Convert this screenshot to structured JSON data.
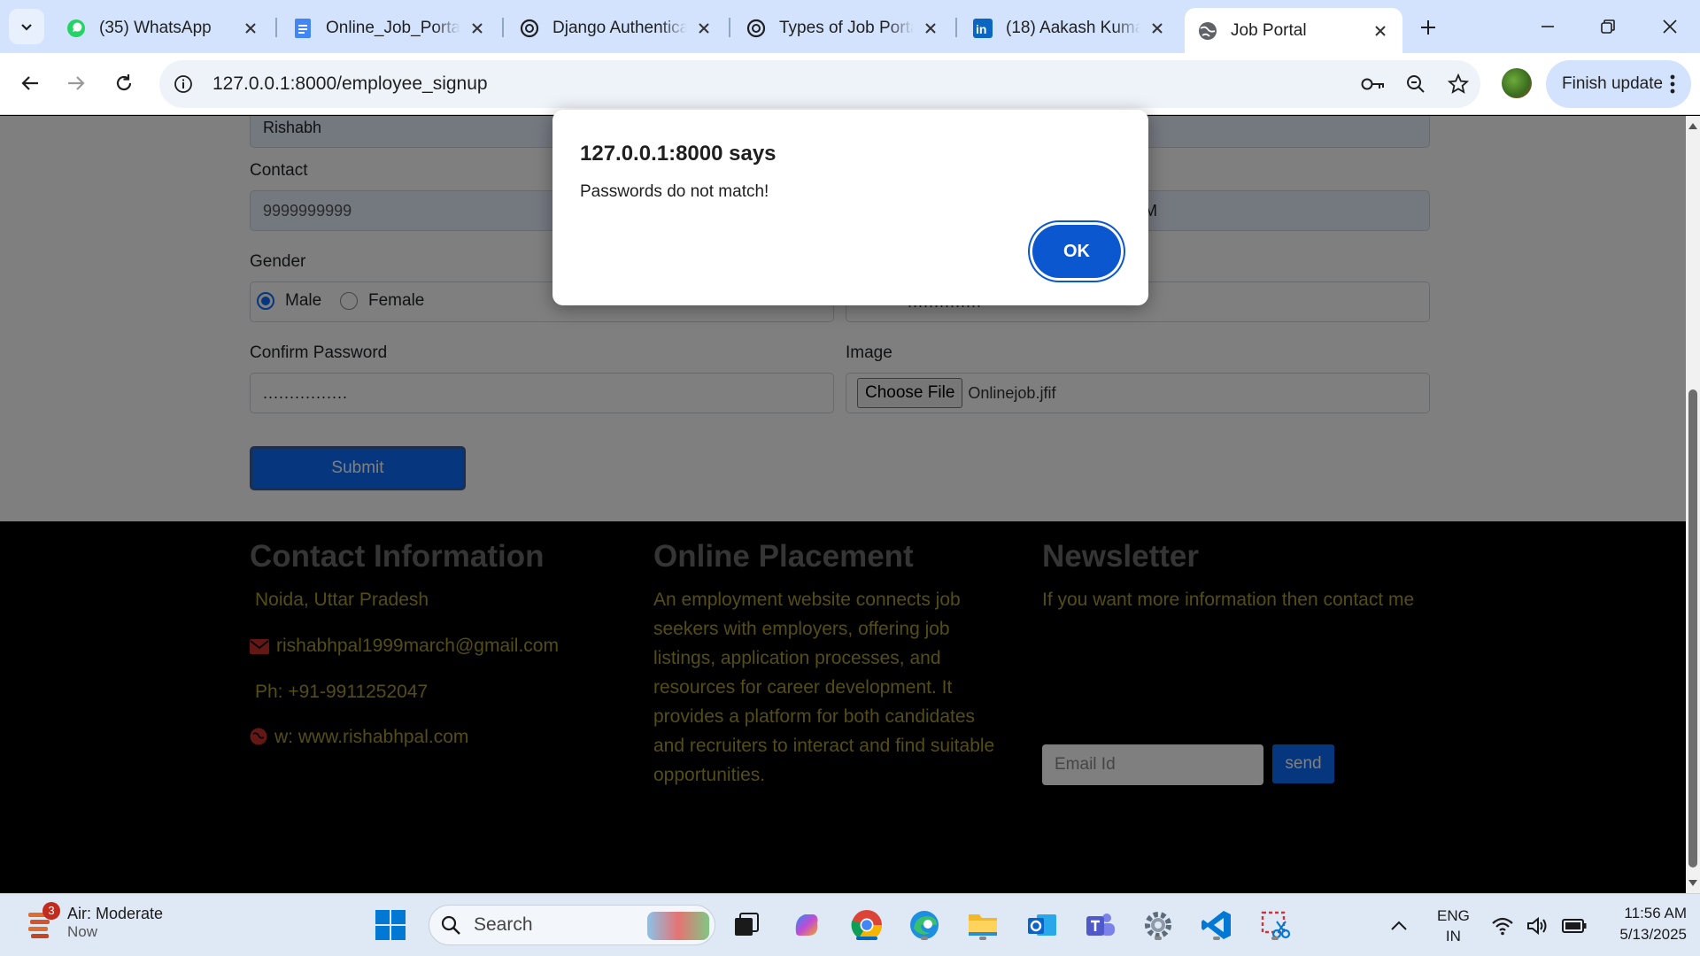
{
  "browser": {
    "tabs": [
      {
        "title": "(35) WhatsApp",
        "icon": "whatsapp-icon"
      },
      {
        "title": "Online_Job_Portal",
        "icon": "docs-icon"
      },
      {
        "title": "Django Authentica",
        "icon": "chatgpt-icon"
      },
      {
        "title": "Types of Job Portal",
        "icon": "chatgpt-icon"
      },
      {
        "title": "(18) Aakash Kumar",
        "icon": "linkedin-icon"
      },
      {
        "title": "Job Portal",
        "icon": "globe-icon",
        "active": true
      }
    ],
    "url": "127.0.0.1:8000/employee_signup",
    "finish_update": "Finish update"
  },
  "form": {
    "first_name_value": "Rishabh",
    "contact_label": "Contact",
    "contact_value": "9999999999",
    "right_top_partial": "M",
    "gender_label": "Gender",
    "gender_options": [
      "Male",
      "Female"
    ],
    "gender_selected": "Male",
    "password_value": "..............",
    "confirm_password_label": "Confirm Password",
    "confirm_password_value": "................",
    "image_label": "Image",
    "choose_file_label": "Choose File",
    "file_name": "Onlinejob.jfif",
    "submit_label": "Submit"
  },
  "footer": {
    "contact": {
      "heading": "Contact Information",
      "location": "Noida, Uttar Pradesh",
      "email": "rishabhpal1999march@gmail.com",
      "phone": "Ph: +91-9911252047",
      "website": "w: www.rishabhpal.com"
    },
    "placement": {
      "heading": "Online Placement",
      "lines": [
        "An employment website connects job",
        "seekers with employers, offering job",
        "listings, application processes, and",
        "resources for career development. It",
        "provides a platform for both candidates",
        "and recruiters to interact and find suitable",
        "opportunities."
      ]
    },
    "newsletter": {
      "heading": "Newsletter",
      "text": "If you want more information then contact me",
      "email_placeholder": "Email Id",
      "send_label": "send"
    }
  },
  "dialog": {
    "title": "127.0.0.1:8000 says",
    "message": "Passwords do not match!",
    "ok_label": "OK"
  },
  "taskbar": {
    "weather_title": "Air: Moderate",
    "weather_sub": "Now",
    "weather_badge": "3",
    "search_label": "Search",
    "lang_top": "ENG",
    "lang_bottom": "IN",
    "time": "11:56 AM",
    "date": "5/13/2025"
  },
  "colors": {
    "accent": "#0d6efd",
    "dialog_button": "#0b57d0",
    "footer_text": "#a89a2f",
    "footer_heading": "#6b6b6b"
  }
}
